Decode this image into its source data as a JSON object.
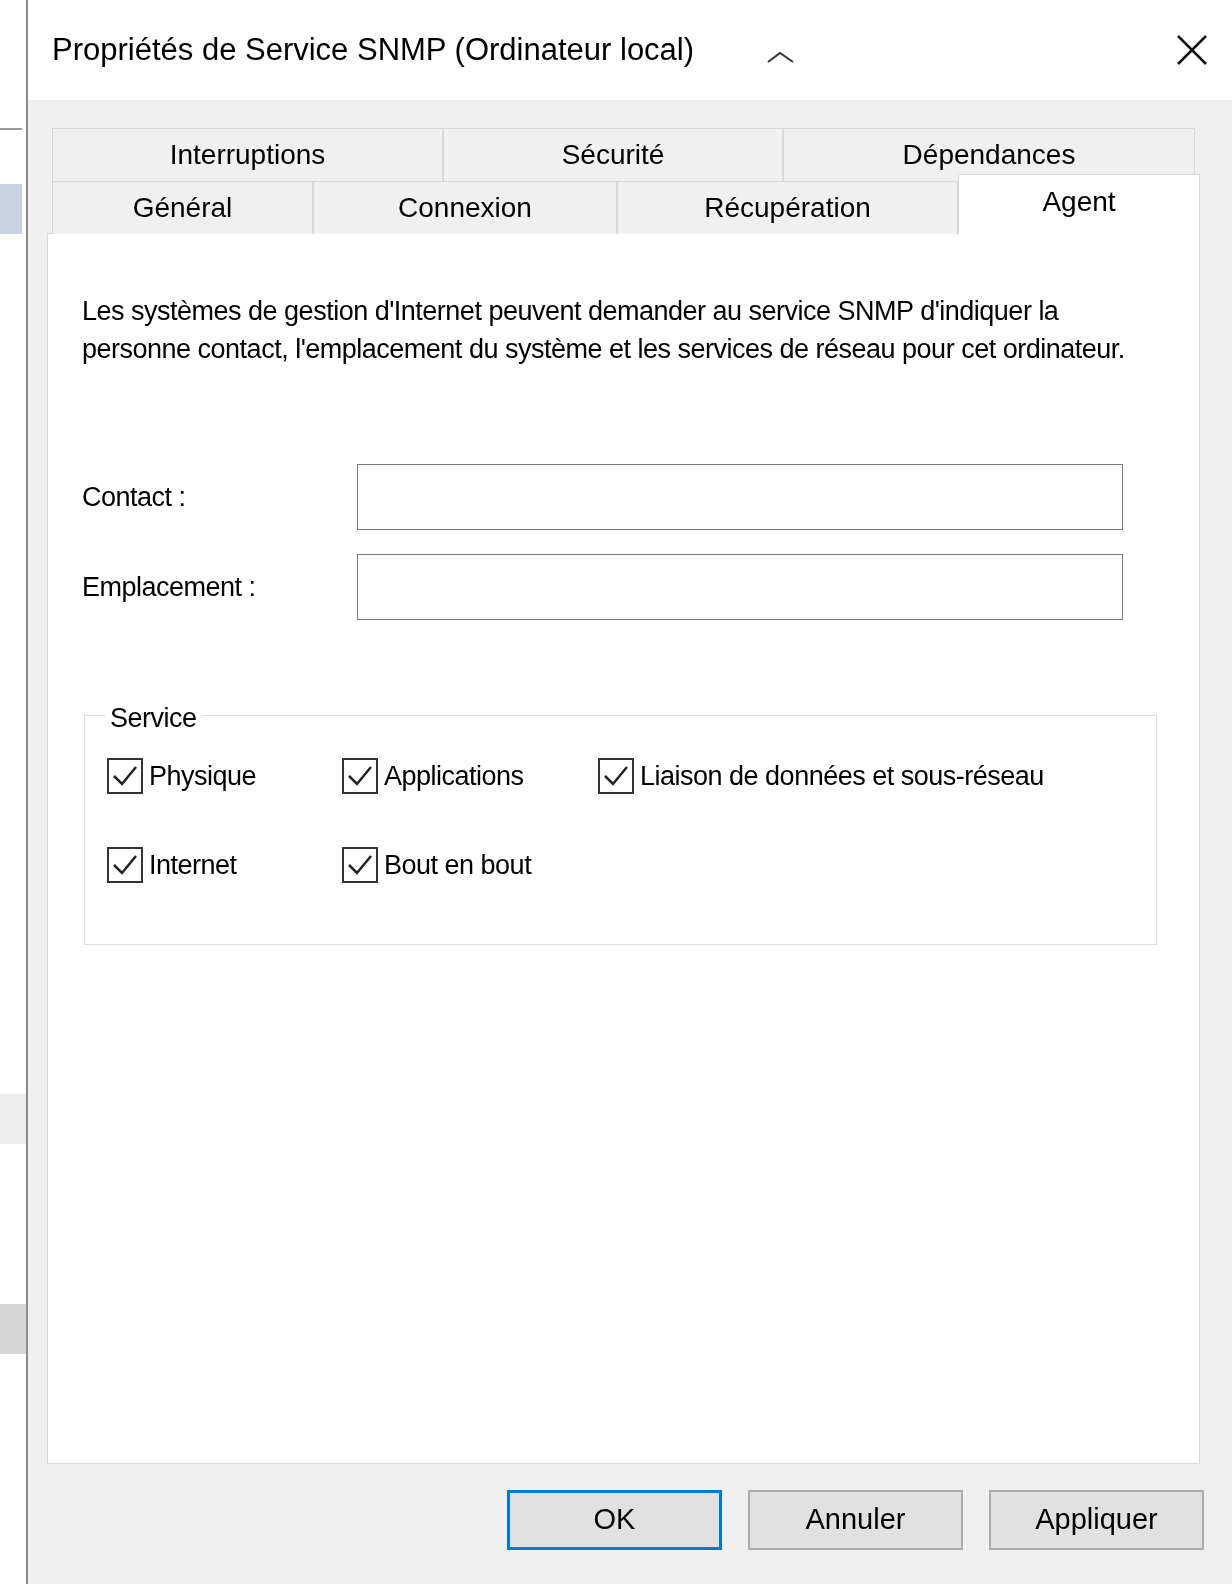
{
  "window": {
    "title": "Propriétés de Service SNMP (Ordinateur local)"
  },
  "tab_rows": [
    [
      {
        "label": "Interruptions",
        "selected": false
      },
      {
        "label": "Sécurité",
        "selected": false
      },
      {
        "label": "Dépendances",
        "selected": false
      }
    ],
    [
      {
        "label": "Général",
        "selected": false
      },
      {
        "label": "Connexion",
        "selected": false
      },
      {
        "label": "Récupération",
        "selected": false
      },
      {
        "label": "Agent",
        "selected": true
      }
    ]
  ],
  "description": "Les systèmes de gestion d'Internet peuvent demander au service SNMP d'indiquer la personne contact, l'emplacement du système et les services de réseau pour cet ordinateur.",
  "fields": [
    {
      "label": "Contact :"
    },
    {
      "label": "Emplacement :"
    }
  ],
  "service_group": {
    "title": "Service",
    "checkboxes": [
      {
        "label": "Physique",
        "checked": true
      },
      {
        "label": "Applications",
        "checked": true
      },
      {
        "label": "Liaison de données et sous-réseau",
        "checked": true
      },
      {
        "label": "Internet",
        "checked": true
      },
      {
        "label": "Bout en bout",
        "checked": true
      }
    ]
  },
  "buttons": [
    {
      "label": "OK",
      "default": true
    },
    {
      "label": "Annuler",
      "default": false
    },
    {
      "label": "Appliquer",
      "default": false
    }
  ]
}
